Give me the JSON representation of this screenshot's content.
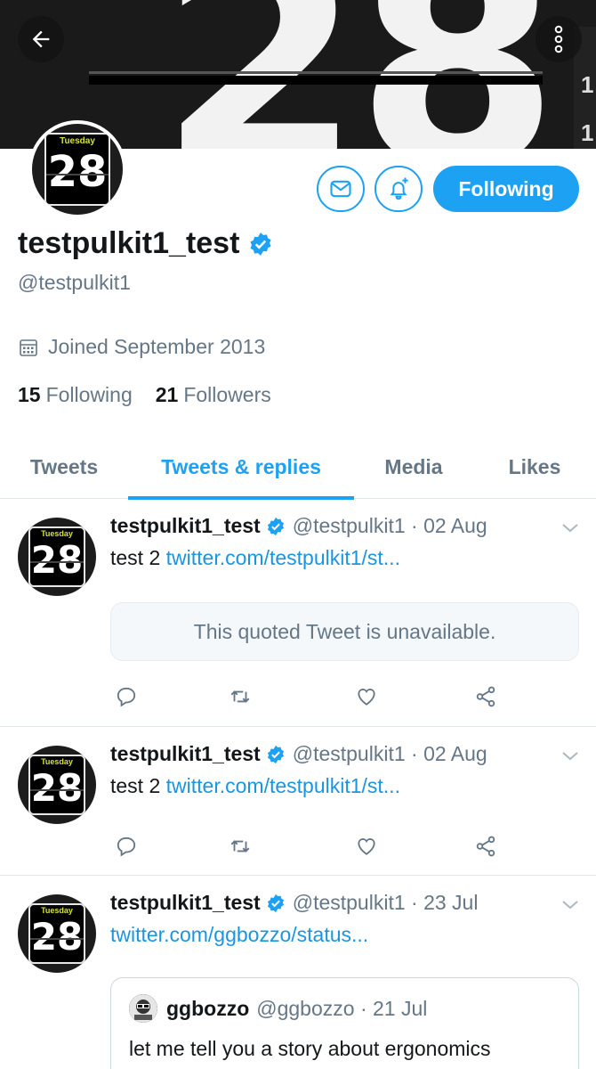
{
  "header": {
    "banner_text": "28",
    "edge_digits": [
      "1",
      "1"
    ]
  },
  "profile": {
    "avatar_day": "Tuesday",
    "avatar_num": "28",
    "display_name": "testpulkit1_test",
    "handle": "@testpulkit1",
    "joined": "Joined September 2013",
    "following_count": "15",
    "following_label": "Following",
    "followers_count": "21",
    "followers_label": "Followers",
    "follow_button": "Following"
  },
  "tabs": [
    {
      "label": "Tweets",
      "active": false
    },
    {
      "label": "Tweets & replies",
      "active": true
    },
    {
      "label": "Media",
      "active": false
    },
    {
      "label": "Likes",
      "active": false
    }
  ],
  "tweets": [
    {
      "name": "testpulkit1_test",
      "meta": "@testpulkit1 · 02 Aug",
      "text": "test 2 ",
      "link": "twitter.com/testpulkit1/st...",
      "quote_unavailable": "This quoted Tweet is unavailable."
    },
    {
      "name": "testpulkit1_test",
      "meta": "@testpulkit1 · 02 Aug",
      "text": "test 2 ",
      "link": "twitter.com/testpulkit1/st..."
    },
    {
      "name": "testpulkit1_test",
      "meta": "@testpulkit1 · 23 Jul",
      "text": "",
      "link": "twitter.com/ggbozzo/status...",
      "quote": {
        "name": "ggbozzo",
        "meta": "@ggbozzo · 21 Jul",
        "text": "let me tell you a story about ergonomics"
      }
    }
  ],
  "colors": {
    "accent": "#1da1f2",
    "link": "#1b95e0",
    "muted": "#657786"
  }
}
